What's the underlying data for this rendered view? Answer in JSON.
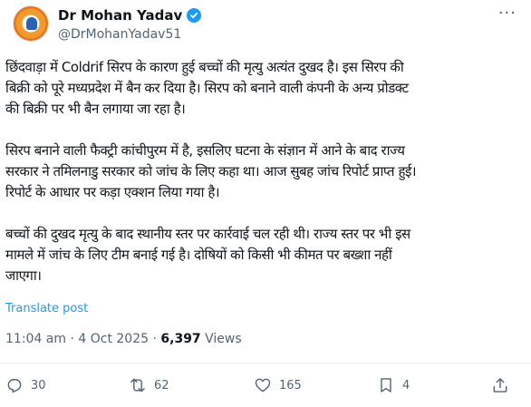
{
  "author": {
    "display_name": "Dr Mohan Yadav",
    "handle": "@DrMohanYadav51",
    "verified_icon": "verified-badge-icon"
  },
  "tweet": {
    "paragraphs": [
      [
        "छिंदवाड़ा में Coldrif सिरप के कारण हुई बच्चों की मृत्यु अत्यंत दुखद है। इस सिरप की",
        "बिक्री को पूरे मध्यप्रदेश में बैन कर दिया है। सिरप को बनाने वाली कंपनी के अन्य प्रोडक्ट",
        "की बिक्री पर भी बैन लगाया जा रहा है।"
      ],
      [
        "सिरप बनाने वाली फैक्ट्री कांचीपुरम में है, इसलिए घटना के संज्ञान में आने के बाद राज्य",
        "सरकार ने तमिलनाडु सरकार को जांच के लिए कहा था। आज सुबह जांच रिपोर्ट प्राप्त हुई।",
        "रिपोर्ट के आधार पर कड़ा एक्शन लिया गया है।"
      ],
      [
        "बच्चों की दुखद मृत्यु के बाद स्थानीय स्तर पर कार्रवाई चल रही थी। राज्य स्तर पर भी इस",
        "मामले में जांच के लिए टीम बनाई गई है। दोषियों को किसी भी कीमत पर बख्शा नहीं",
        "जाएगा।"
      ]
    ],
    "translate_label": "Translate post"
  },
  "meta": {
    "time": "11:04 am",
    "date": "4 Oct 2025",
    "separator": "·",
    "views_count": "6,397",
    "views_label": "Views"
  },
  "actions": {
    "replies": "30",
    "reposts": "62",
    "likes": "165",
    "bookmarks": "4"
  },
  "colors": {
    "accent": "#1d9bf0",
    "secondary_text": "#536471",
    "primary_text": "#0f1419"
  }
}
